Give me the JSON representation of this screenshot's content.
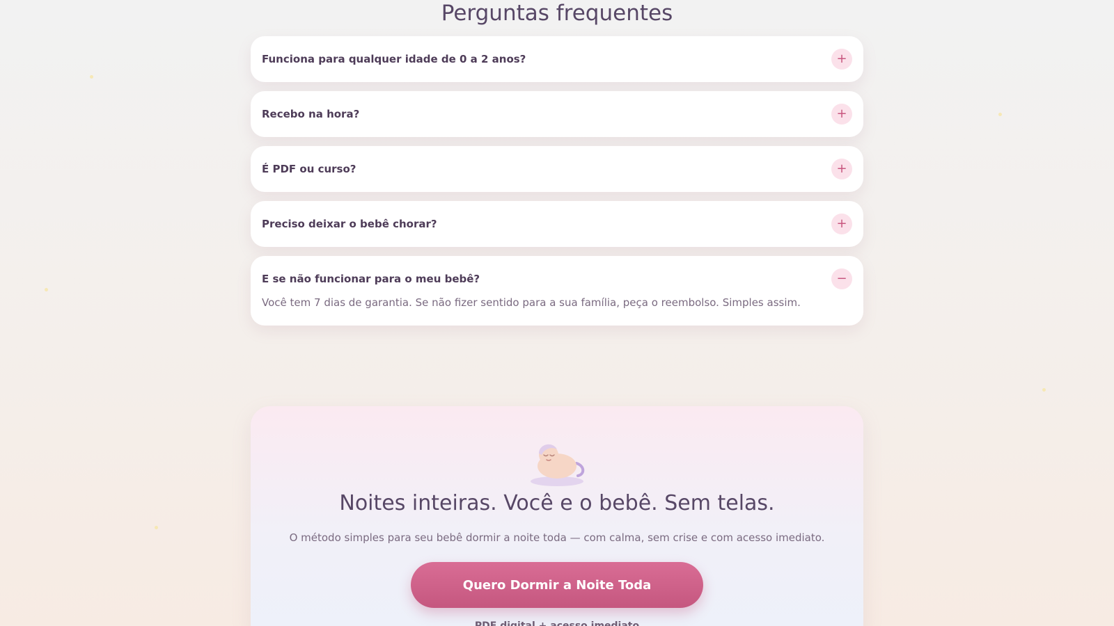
{
  "faq": {
    "title": "Perguntas frequentes",
    "items": [
      {
        "question": "Funciona para qualquer idade de 0 a 2 anos?",
        "icon": "plus-icon",
        "symbol": "+",
        "expanded": false
      },
      {
        "question": "Recebo na hora?",
        "icon": "plus-icon",
        "symbol": "+",
        "expanded": false
      },
      {
        "question": "É PDF ou curso?",
        "icon": "plus-icon",
        "symbol": "+",
        "expanded": false
      },
      {
        "question": "Preciso deixar o bebê chorar?",
        "icon": "plus-icon",
        "symbol": "+",
        "expanded": false
      },
      {
        "question": "E se não funcionar para o meu bebê?",
        "icon": "minus-icon",
        "symbol": "−",
        "expanded": true,
        "answer": "Você tem 7 dias de garantia. Se não fizer sentido para a sua família, peça o reembolso. Simples assim."
      }
    ]
  },
  "cta": {
    "illustration": "sleeping-baby-icon",
    "title": "Noites inteiras. Você e o bebê. Sem telas.",
    "subtitle": "O método simples para seu bebê dormir a noite toda — com calma, sem crise e com acesso imediato.",
    "button_label": "Quero Dormir a Noite Toda",
    "note": "PDF digital + acesso imediato"
  },
  "colors": {
    "accent": "#c8567f",
    "heading": "#574766",
    "toggle_bg": "#fbe1ea"
  }
}
